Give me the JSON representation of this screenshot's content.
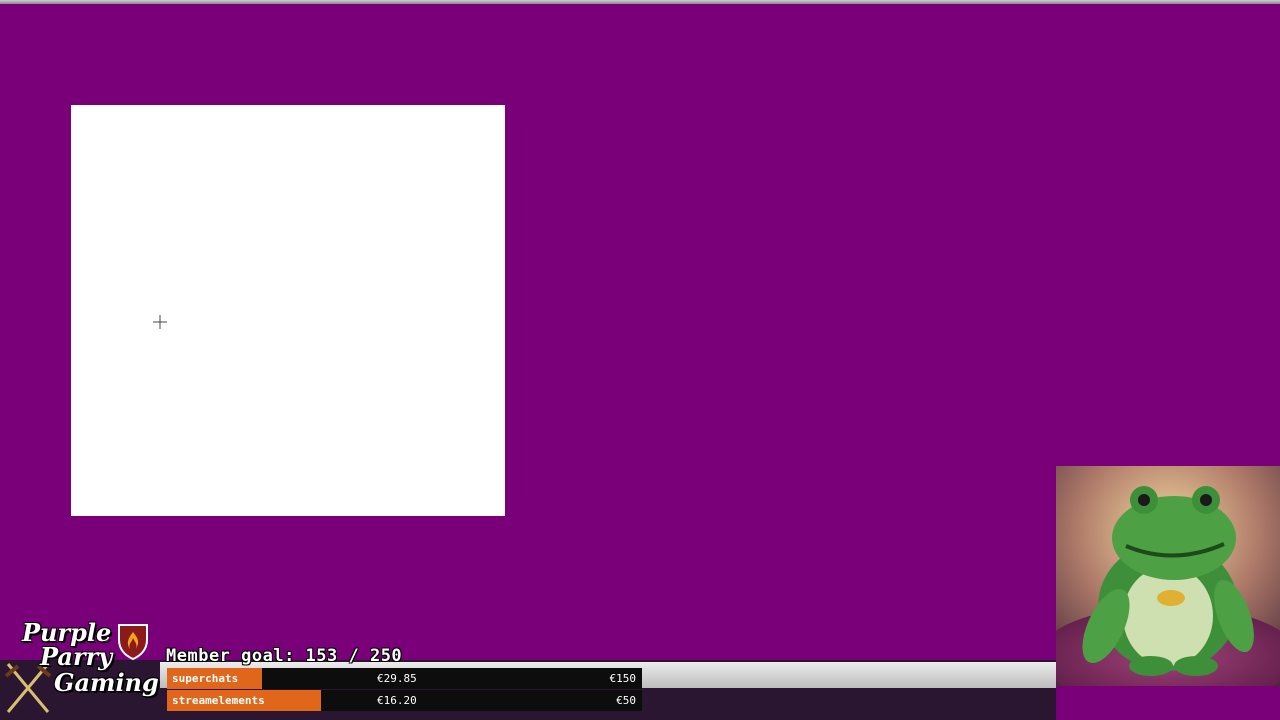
{
  "overlay": {
    "member_goal": "Member goal: 153 / 250",
    "member_goal_current": 153,
    "member_goal_target": 250
  },
  "goals": [
    {
      "label": "superchats",
      "amount": "€29.85",
      "target": "€150",
      "progress": 0.199
    },
    {
      "label": "streamelements",
      "amount": "€16.20",
      "target": "€50",
      "progress": 0.324
    }
  ],
  "logo": {
    "line1": "Purple",
    "line2": "Parry",
    "line3": "Gaming"
  },
  "icons": {
    "cursor": "crosshair-icon",
    "shield": "flame-shield-icon",
    "swords": "crossed-swords-icon"
  },
  "colors": {
    "background": "#7a007a",
    "goal_fill": "#e0661c",
    "goal_bar": "#0d0d0d"
  }
}
